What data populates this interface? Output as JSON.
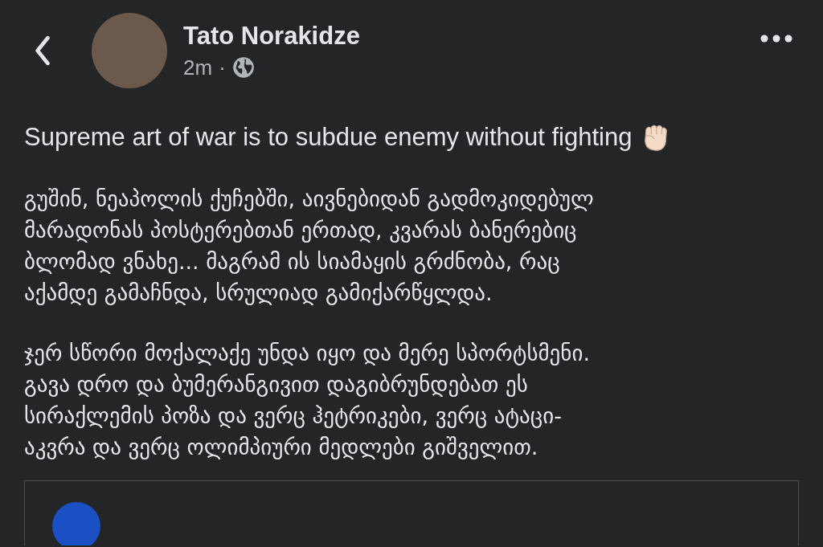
{
  "post": {
    "author": "Tato Norakidze",
    "time": "2m",
    "separator": "·",
    "headline": "Supreme art of war is to subdue enemy without fighting",
    "paragraphs": [
      {
        "lines": [
          "გუშინ, ნეაპოლის ქუჩებში, აივნებიდან გადმოკიდებულ",
          "მარადონას პოსტერებთან ერთად, კვარას ბანერებიც",
          "ბლომად ვნახე... მაგრამ ის სიამაყის გრძნობა, რაც",
          "აქამდე გამაჩნდა, სრულიად გამიქარწყლდა."
        ]
      },
      {
        "lines": [
          "ჯერ სწორი მოქალაქე უნდა იყო და მერე სპორტსმენი.",
          "გავა დრო და ბუმერანგივით დაგიბრუნდებათ ეს",
          "სირაქლემის პოზა და ვერც ჰეტრიკები, ვერც ატაცი-",
          "აკვრა და ვერც ოლიმპიური მედლები გიშველით."
        ]
      }
    ]
  }
}
